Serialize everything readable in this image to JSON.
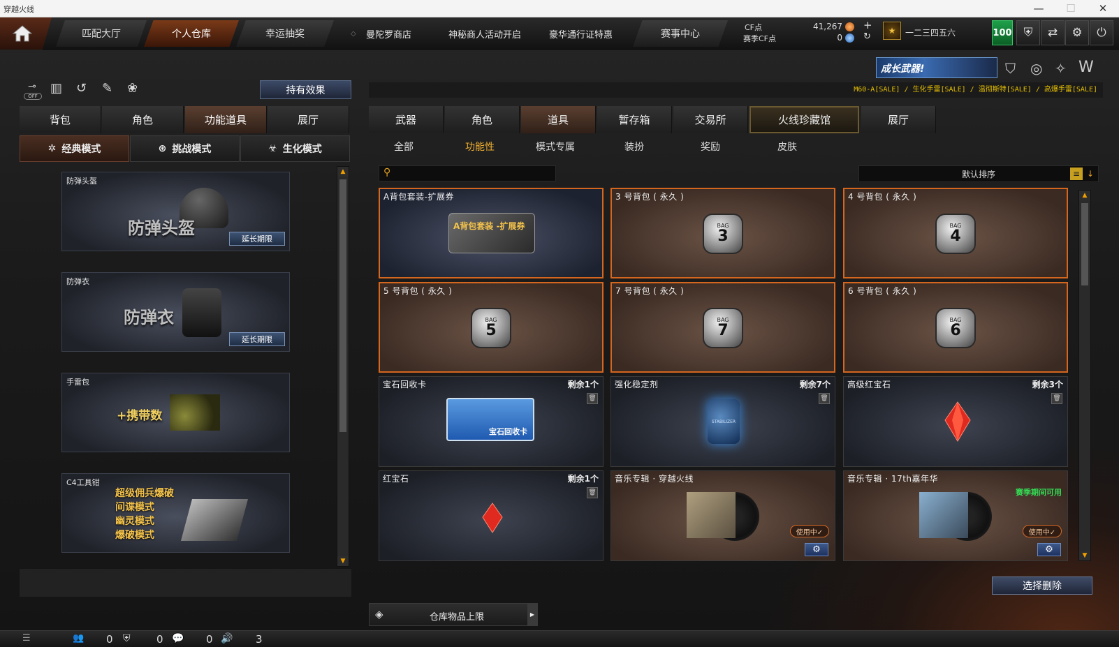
{
  "window": {
    "title": "穿越火线"
  },
  "nav": {
    "tabs": [
      "匹配大厅",
      "个人仓库",
      "幸运抽奖"
    ],
    "active": 1,
    "links": [
      "曼陀罗商店",
      "神秘商人活动开启",
      "豪华通行证特惠"
    ],
    "event": "赛事中心"
  },
  "currency": {
    "cf_label": "CF点",
    "cf_value": "41,267",
    "season_label": "赛季CF点",
    "season_value": "0"
  },
  "user": {
    "name": "一二三四五六",
    "level": "100"
  },
  "banner": {
    "text": "成长武器!"
  },
  "ticker": "M60-A[SALE] / 生化手雷[SALE] / 温彻斯特[SALE] / 高爆手雷[SALE]",
  "left": {
    "effect_button": "持有效果",
    "off_label": "OFF",
    "tabs": [
      "背包",
      "角色",
      "功能道具",
      "展厅"
    ],
    "active_tab": 2,
    "modes": [
      "经典模式",
      "挑战模式",
      "生化模式"
    ],
    "active_mode": 0,
    "items": [
      {
        "name": "防弹头盔",
        "big": "防弹头盔",
        "extend": "延长期限"
      },
      {
        "name": "防弹衣",
        "big": "防弹衣",
        "extend": "延长期限"
      },
      {
        "name": "手雷包",
        "big": "+携带数",
        "extend": ""
      },
      {
        "name": "C4工具钳",
        "lines": [
          "超级佣兵爆破",
          "间谍模式",
          "幽灵模式",
          "爆破模式"
        ],
        "extend": ""
      }
    ]
  },
  "right": {
    "tabs": [
      "武器",
      "角色",
      "道具",
      "暂存箱",
      "交易所",
      "火线珍藏馆",
      "展厅"
    ],
    "active_tab": 2,
    "subtabs": [
      "全部",
      "功能性",
      "模式专属",
      "装扮",
      "奖励",
      "皮肤"
    ],
    "active_subtab": 1,
    "search_placeholder": "",
    "sort": "默认排序",
    "cards": [
      {
        "name": "A背包套装-扩展券",
        "remain": "",
        "art": "A背包套装 -扩展券"
      },
      {
        "name": "3 号背包 ( 永久 )",
        "remain": "",
        "bag": "3"
      },
      {
        "name": "4 号背包 ( 永久 )",
        "remain": "",
        "bag": "4"
      },
      {
        "name": "5 号背包 ( 永久 )",
        "remain": "",
        "bag": "5"
      },
      {
        "name": "7 号背包 ( 永久 )",
        "remain": "",
        "bag": "7"
      },
      {
        "name": "6 号背包 ( 永久 )",
        "remain": "",
        "bag": "6"
      },
      {
        "name": "宝石回收卡",
        "remain": "剩余1个",
        "art": "宝石回收卡"
      },
      {
        "name": "强化稳定剂",
        "remain": "剩余7个",
        "art": "STABILIZER"
      },
      {
        "name": "高级红宝石",
        "remain": "剩余3个"
      },
      {
        "name": "红宝石",
        "remain": "剩余1个"
      },
      {
        "name": "音乐专辑 · 穿越火线",
        "remain": "",
        "status": "使用中✓"
      },
      {
        "name": "音乐专辑 · 17th嘉年华",
        "remain": "",
        "status": "使用中✓",
        "note": "赛季期间可用"
      }
    ],
    "bag_label": "BAG",
    "delete_button": "选择删除",
    "storage_label": "仓库物品上限"
  },
  "bottom": {
    "c1": "0",
    "c2": "0",
    "c3": "0",
    "c4": "3"
  }
}
